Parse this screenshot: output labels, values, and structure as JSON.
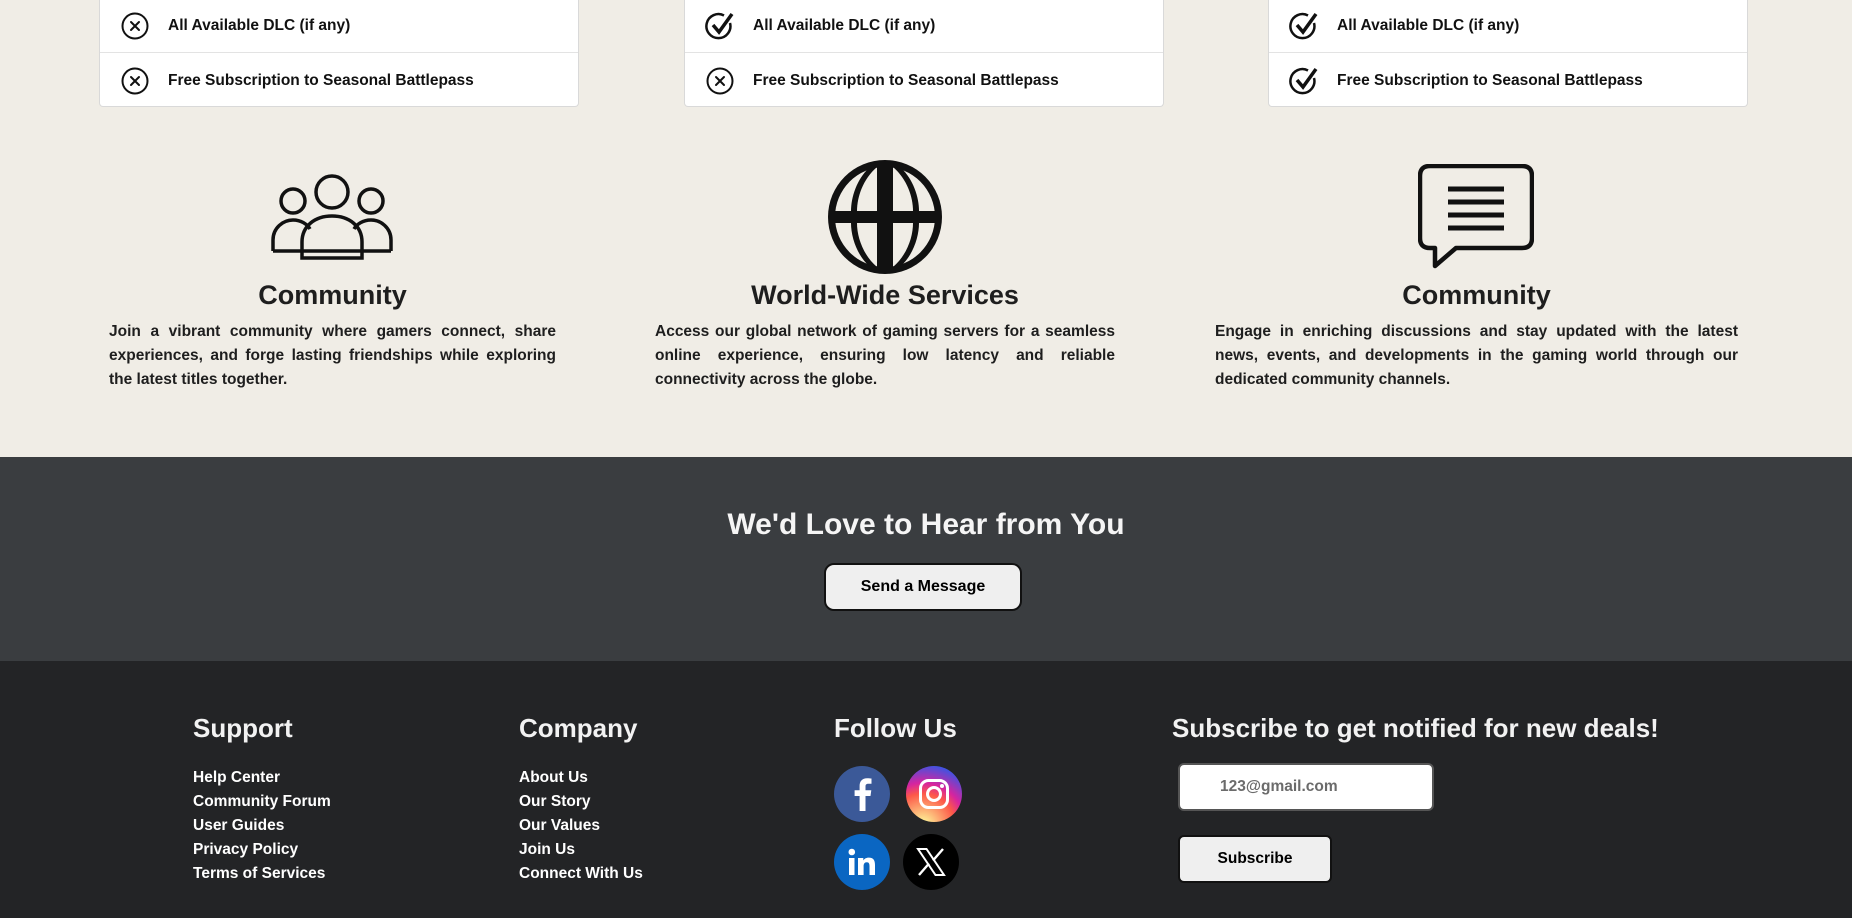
{
  "pricing_cards": [
    {
      "rows": [
        {
          "label": "All Available DLC (if any)",
          "status": "excluded",
          "icon": "x-circle-icon"
        },
        {
          "label": "Free Subscription to Seasonal Battlepass",
          "status": "excluded",
          "icon": "x-circle-icon"
        }
      ]
    },
    {
      "rows": [
        {
          "label": "All Available DLC (if any)",
          "status": "included",
          "icon": "check-circle-icon"
        },
        {
          "label": "Free Subscription to Seasonal Battlepass",
          "status": "excluded",
          "icon": "x-circle-icon"
        }
      ]
    },
    {
      "rows": [
        {
          "label": "All Available DLC (if any)",
          "status": "included",
          "icon": "check-circle-icon"
        },
        {
          "label": "Free Subscription to Seasonal Battlepass",
          "status": "included",
          "icon": "check-circle-icon"
        }
      ]
    }
  ],
  "features": [
    {
      "icon": "people-icon",
      "title": "Community",
      "text": "Join a vibrant community where gamers connect, share experiences, and forge lasting friendships while exploring the latest titles together."
    },
    {
      "icon": "globe-icon",
      "title": "World-Wide Services",
      "text": "Access our global network of gaming servers for a seamless online experience, ensuring low latency and reliable connectivity across the globe."
    },
    {
      "icon": "chat-bubble-icon",
      "title": "Community",
      "text": "Engage in enriching discussions and stay updated with the latest news, events, and developments in the gaming world through our dedicated community channels."
    }
  ],
  "contact": {
    "heading": "We'd Love to Hear from You",
    "button_label": "Send a Message"
  },
  "footer": {
    "support": {
      "heading": "Support",
      "links": [
        "Help Center",
        "Community Forum",
        "User Guides",
        "Privacy Policy",
        "Terms of Services"
      ]
    },
    "company": {
      "heading": "Company",
      "links": [
        "About Us",
        "Our Story",
        "Our Values",
        "Join Us",
        "Connect With Us"
      ]
    },
    "follow": {
      "heading": "Follow Us",
      "networks": [
        "facebook-icon",
        "instagram-icon",
        "linkedin-icon",
        "x-icon"
      ]
    },
    "subscribe": {
      "heading": "Subscribe to get notified for new deals!",
      "email_placeholder": "123@gmail.com",
      "button_label": "Subscribe"
    }
  },
  "colors": {
    "page_bg": "#f0ede6",
    "contact_bg": "#3a3d40",
    "footer_bg": "#232426",
    "facebook": "#3b5998",
    "linkedin": "#0a66c2",
    "x": "#000000"
  }
}
